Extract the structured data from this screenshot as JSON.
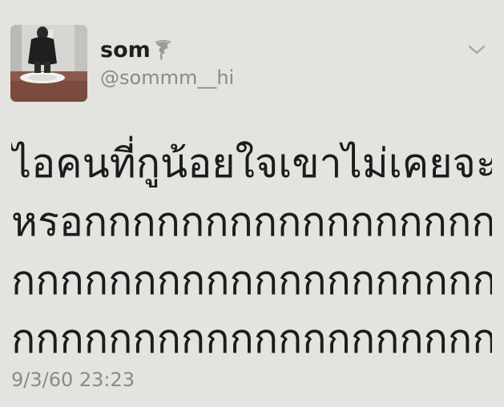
{
  "user": {
    "display_name": "som",
    "username": "@sommm__hi"
  },
  "tweet": {
    "text_lines": [
      "ไอคนที่กูน้อยใจเขาไม่เคยจะรู้",
      "หรอกกกกกกกกกกกกกกกกกก",
      "กกกกกกกกกกกกกกกกกกกกก",
      "กกกกกกกกกกกกกกกกกกกก"
    ],
    "timestamp": "9/3/60 23:23"
  },
  "icons": {
    "name_emoji": "tornado-icon",
    "menu": "chevron-down-icon"
  },
  "colors": {
    "background": "#e3e3e0",
    "text": "#1c1c1c",
    "secondary_text": "#8a8a88"
  }
}
